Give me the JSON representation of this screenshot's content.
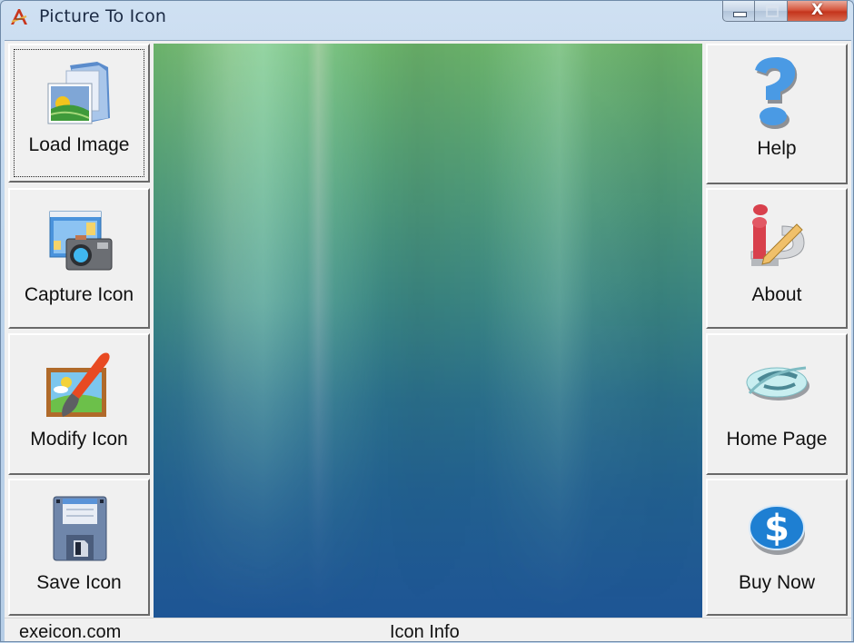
{
  "window": {
    "title": "Picture To Icon",
    "app_icon": "picture-to-icon-app-icon",
    "controls": {
      "minimize": "minimize-icon",
      "maximize": "maximize-icon",
      "close_glyph": "X"
    }
  },
  "left_toolbar": [
    {
      "id": "load-image",
      "label": "Load Image",
      "icon": "folder-picture-icon",
      "focused": true
    },
    {
      "id": "capture-icon",
      "label": "Capture Icon",
      "icon": "camera-capture-icon",
      "focused": false
    },
    {
      "id": "modify-icon",
      "label": "Modify Icon",
      "icon": "paintbrush-picture-icon",
      "focused": false
    },
    {
      "id": "save-icon",
      "label": "Save Icon",
      "icon": "floppy-disk-icon",
      "focused": false
    }
  ],
  "right_toolbar": [
    {
      "id": "help",
      "label": "Help",
      "icon": "question-mark-icon"
    },
    {
      "id": "about",
      "label": "About",
      "icon": "info-pencil-icon"
    },
    {
      "id": "home-page",
      "label": "Home Page",
      "icon": "internet-explorer-icon"
    },
    {
      "id": "buy-now",
      "label": "Buy Now",
      "icon": "dollar-coin-icon"
    }
  ],
  "preview": {
    "description": "image-preview-canvas",
    "colors": {
      "top": "#6bb26a",
      "middle": "#3a8582",
      "bottom": "#1e5595"
    }
  },
  "statusbar": {
    "left": "exeicon.com",
    "center": "Icon Info"
  }
}
